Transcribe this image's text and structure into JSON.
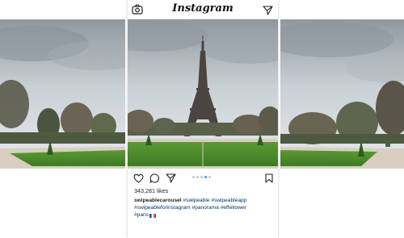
{
  "app": {
    "logo_text": "Instagram"
  },
  "top_bar": {
    "left_icon": "camera-icon",
    "right_icon": "direct-message-icon"
  },
  "post": {
    "likes": "343,281 likes",
    "username": "swipeablecarousel",
    "hashtags": [
      "#swipeable",
      "#swipeableapp",
      "#swipeableforinstagram",
      "#panorama",
      "#effeltower",
      "#paris"
    ],
    "flag_icon": "france-flag-icon",
    "carousel": {
      "total": 5,
      "active_index": 3
    }
  },
  "actions": {
    "icons": [
      "heart-icon",
      "comment-icon",
      "share-icon",
      "save-icon"
    ]
  },
  "colors": {
    "accent_blue": "#3897f0",
    "hashtag": "#003569",
    "text": "#262626",
    "grass": "#4f8a2e",
    "sky": "#b8c0c6"
  }
}
